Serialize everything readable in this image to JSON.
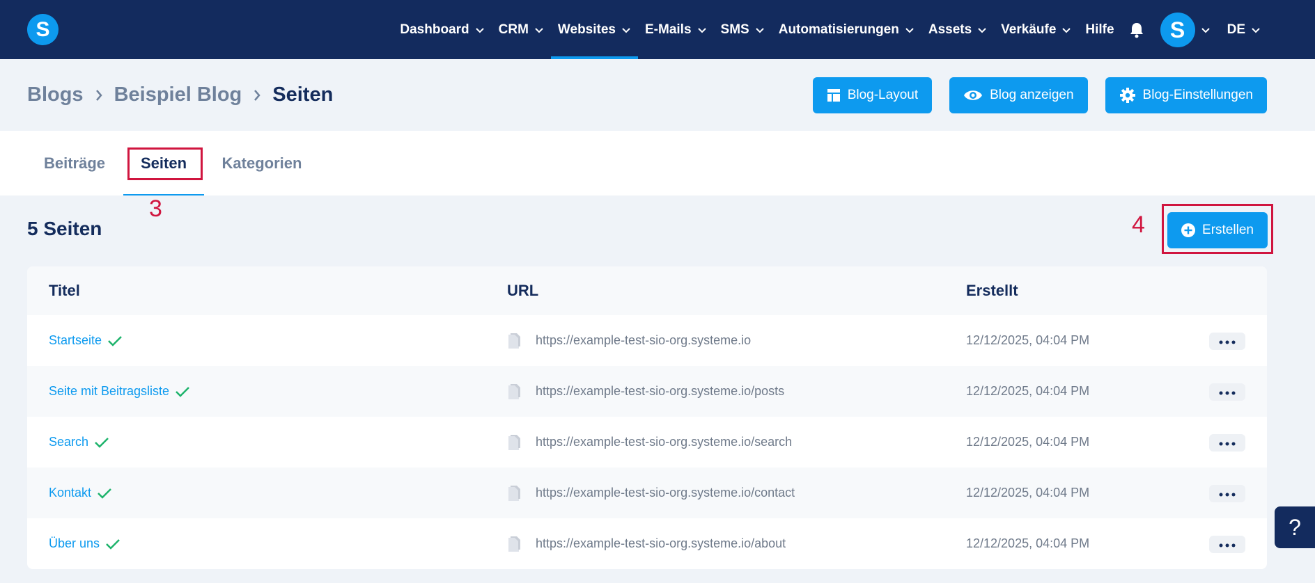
{
  "brand": {
    "logo_letter": "S",
    "accent": "#0d9aef",
    "nav_bg": "#132b5e",
    "annotation_color": "#d0153f"
  },
  "nav": {
    "items": [
      {
        "label": "Dashboard",
        "dropdown": true
      },
      {
        "label": "CRM",
        "dropdown": true
      },
      {
        "label": "Websites",
        "dropdown": true,
        "active": true
      },
      {
        "label": "E-Mails",
        "dropdown": true
      },
      {
        "label": "SMS",
        "dropdown": true
      },
      {
        "label": "Automatisierungen",
        "dropdown": true
      },
      {
        "label": "Assets",
        "dropdown": true
      },
      {
        "label": "Verkäufe",
        "dropdown": true
      },
      {
        "label": "Hilfe",
        "dropdown": false
      }
    ],
    "avatar_letter": "S",
    "language": "DE"
  },
  "breadcrumb": {
    "items": [
      "Blogs",
      "Beispiel Blog",
      "Seiten"
    ]
  },
  "header_buttons": {
    "layout": "Blog-Layout",
    "view": "Blog anzeigen",
    "settings": "Blog-Einstellungen"
  },
  "tabs": {
    "posts": "Beiträge",
    "pages": "Seiten",
    "categories": "Kategorien"
  },
  "annotations": {
    "tab_marker": "3",
    "create_marker": "4"
  },
  "section": {
    "title": "5 Seiten",
    "create_label": "Erstellen"
  },
  "table": {
    "headers": {
      "title": "Titel",
      "url": "URL",
      "created": "Erstellt"
    },
    "rows": [
      {
        "title": "Startseite",
        "url": "https://example-test-sio-org.systeme.io",
        "created": "12/12/2025, 04:04 PM"
      },
      {
        "title": "Seite mit Beitragsliste",
        "url": "https://example-test-sio-org.systeme.io/posts",
        "created": "12/12/2025, 04:04 PM"
      },
      {
        "title": "Search",
        "url": "https://example-test-sio-org.systeme.io/search",
        "created": "12/12/2025, 04:04 PM"
      },
      {
        "title": "Kontakt",
        "url": "https://example-test-sio-org.systeme.io/contact",
        "created": "12/12/2025, 04:04 PM"
      },
      {
        "title": "Über uns",
        "url": "https://example-test-sio-org.systeme.io/about",
        "created": "12/12/2025, 04:04 PM"
      }
    ]
  },
  "help": {
    "label": "?"
  }
}
